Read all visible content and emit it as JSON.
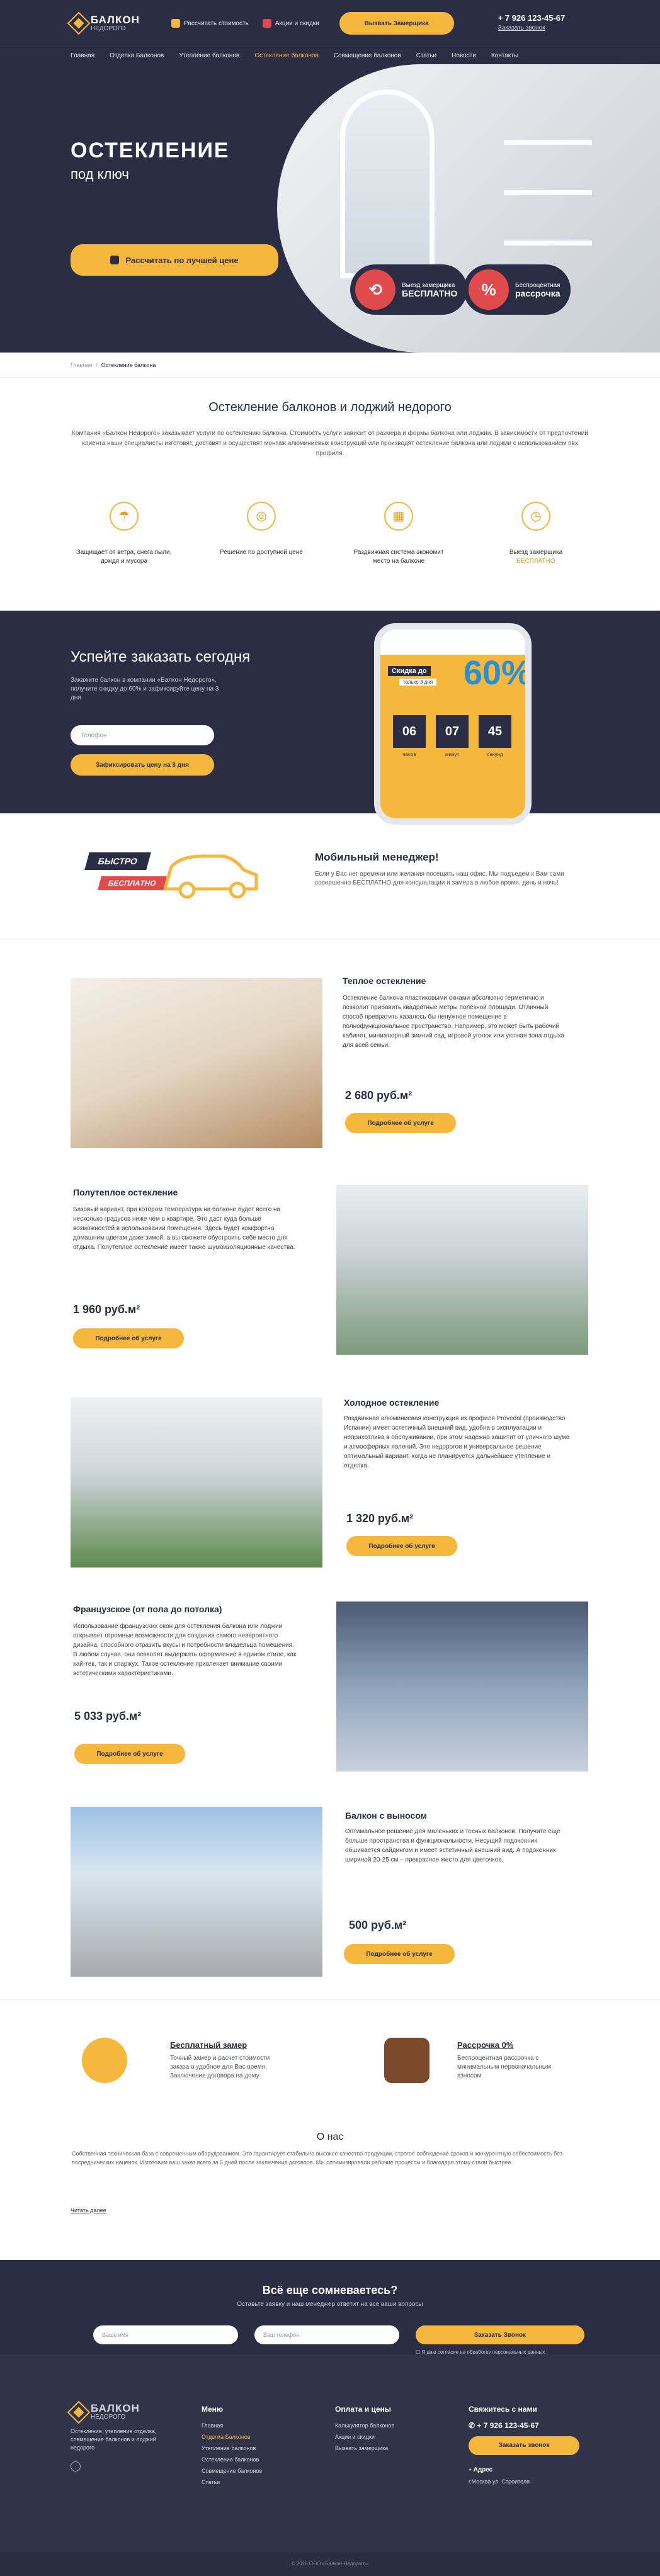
{
  "header": {
    "logo_title": "БАЛКОН",
    "logo_sub": "НЕДОРОГО",
    "link1": "Рассчитать стоимость",
    "link2": "Акции и скидки",
    "call_btn": "Вызвать Замерщика",
    "phone": "+ 7 926 123-45-67",
    "callback": "Заказать звонок"
  },
  "nav": [
    "Главная",
    "Отделка Балконов",
    "Утепление балконов",
    "Остекление балконов",
    "Совмещение балконов",
    "Статьи",
    "Новости",
    "Контакты"
  ],
  "hero": {
    "title": "ОСТЕКЛЕНИЕ",
    "subtitle": "под ключ",
    "button": "Рассчитать по лучшей цене",
    "badge1_top": "Выезд замерщика",
    "badge1_main": "БЕСПЛАТНО",
    "badge2_top": "Беспроцентная",
    "badge2_main": "рассрочка",
    "badge2_icon": "%"
  },
  "breadcrumb": {
    "home": "Главная",
    "current": "Остекление балкона"
  },
  "about": {
    "title": "Остекление балконов и лоджий недорого",
    "text": "Компания «Балкон Недорого» заказывает услуги по остеклению балкона. Стоимость услуги зависит от размера и формы балкона или лоджии. В зависимости от предпочтений клиента наши специалисты изготовят, доставят и осуществят монтаж алюминиевых конструкций или производят остекление балкона или лоджии с использованием пвх профиля."
  },
  "features": [
    {
      "text": "Защищает от ветра, снега пыли, дождя и мусора",
      "hl": ""
    },
    {
      "text": "Решение по доступной цене",
      "hl": ""
    },
    {
      "text": "Раздвижная система экономит место на балконе",
      "hl": ""
    },
    {
      "text": "Выезд замерщика",
      "hl": "БЕСПЛАТНО"
    }
  ],
  "promo": {
    "title": "Успейте заказать сегодня",
    "text": "Закажите балкон в компании «Балкон Недорого», получите скидку до 60% и зафиксируйте цену на 3 дня",
    "input_placeholder": "Телефон",
    "button": "Зафиксировать цену на 3 дня",
    "sale_label": "Скидка до",
    "sale_only": "только 3 дня",
    "sale_value": "60%",
    "timer": [
      {
        "v": "06",
        "l": "часов"
      },
      {
        "v": "07",
        "l": "минут"
      },
      {
        "v": "45",
        "l": "секунд"
      }
    ]
  },
  "mobile": {
    "badge1": "БЫСТРО",
    "badge2": "БЕСПЛАТНО",
    "title": "Мобильный менеджер!",
    "text": "Если у Вас нет времени или желания посещать наш офис, Мы подъедем к Вам сами совершенно БЕСПЛАТНО для консультации и замера в любое время, день и ночь!"
  },
  "products": [
    {
      "title": "Теплое остекление",
      "text": "Остекление балкона пластиковыми окнами абсолютно герметично и позволит прибавить квадратные метры полезной площади. Отличный способ превратить казалось бы ненужное помещение в полнофункциональное пространство. Например, это может быть рабочий кабинет, миниатюрный зимний сад, игровой уголок или уютная зона отдыха для всей семьи.",
      "price": "2 680 руб.м²",
      "button": "Подробнее об услуге"
    },
    {
      "title": "Полутеплое остекление",
      "text": "Базовый вариант, при котором температура на балконе будет всего на несколько градусов ниже чем в квартире. Это даст куда больше возможностей в использовании помещения. Здесь будет комфортно домашним цветам даже зимой, а вы сможете обустроить себе место для отдыха. Полутеплое остекление имеет также шумоизоляционные качества.",
      "price": "1 960 руб.м²",
      "button": "Подробнее об услуге"
    },
    {
      "title": "Холодное остекление",
      "text": "Раздвижная алюминиевая конструкция из профиля Provedal (производство Испании) имеет эстетичный внешний вид, удобна в эксплуатации и неприхотлива в обслуживании, при этом надежно защитит от уличного шума и атмосферных явлений. Это недорогое и универсальное решение оптимальный вариант, когда не планируется дальнейшее утепление и отделка.",
      "price": "1 320 руб.м²",
      "button": "Подробнее об услуге"
    },
    {
      "title": "Французское (от пола до потолка)",
      "text": "Использование французских окон для остекления балкона или лоджии открывает огромные возможности для создания самого невероятного дизайна, способного отразить вкусы и потребности владельца помещения. В любом случае, они позволят выдержать оформление в едином стиле, как хай-тек, так и спаржух. Такое остекление привлекает внимание своими эстетическими характеристиками.",
      "price": "5 033 руб.м²",
      "button": "Подробнее об услуге"
    },
    {
      "title": "Балкон с выносом",
      "text": "Оптимальное решение для маленьких и тесных балконов. Получите еще больше пространства и функциональности. Несущий подоконник обшивается сайдингом и имеет эстетичный внешний вид. А подоконник шириной 20-25 см – прекрасное место для цветочков.",
      "price": "500 руб.м²",
      "button": "Подробнее об услуге"
    }
  ],
  "extras": [
    {
      "title": "Бесплатный замер",
      "text": "Точный замер и расчет стоимости заказа в удобное для Вас время. Заключение договора на дому"
    },
    {
      "title": "Рассрочка 0%",
      "text": "Беспроцентная рассрочка с минимальным первоначальным взносом"
    }
  ],
  "seo": {
    "title": "О нас",
    "text": "Собственная техническая база с современным оборудованием. Это гарантирует стабильно высокое качество продукции, строгое соблюдение сроков и конкурентную себестоимость без посреднических наценок. Изготовим ваш заказ всего за 5 дней после заключения договора. Мы оптимизировали рабочие процессы и благодаря этому стали быстрее.",
    "more": "Читать далее"
  },
  "cta": {
    "title": "Всё еще сомневаетесь?",
    "sub": "Оставьте заявку и наш менеджер ответит на все ваши вопросы",
    "name_ph": "Ваше имя",
    "phone_ph": "Ваш телефон",
    "button": "Заказать Звонок",
    "agree": "Я даю согласие на обработку персональных данных"
  },
  "footer": {
    "logo_title": "БАЛКОН",
    "logo_sub": "НЕДОРОГО",
    "about": "Остекление, утепление отделка, совмещение балконов и лоджий недорого",
    "menu_title": "Меню",
    "menu": [
      "Главная",
      "Отделка Балконов",
      "Утепление балконов",
      "Остекление балконов",
      "Совмещение балконов",
      "Статьи"
    ],
    "pay_title": "Оплата и цены",
    "pay": [
      "Калькулятор балконов",
      "Акции и скидки",
      "Вызвать замерщика"
    ],
    "contact_title": "Свяжитесь с нами",
    "phone": "+ 7 926 123-45-67",
    "button": "Заказать звонок",
    "addr_title": "Адрес",
    "addr": "г.Москва ул. Строителя",
    "copy": "© 2018 ООО «Балкон-Недорого»"
  }
}
